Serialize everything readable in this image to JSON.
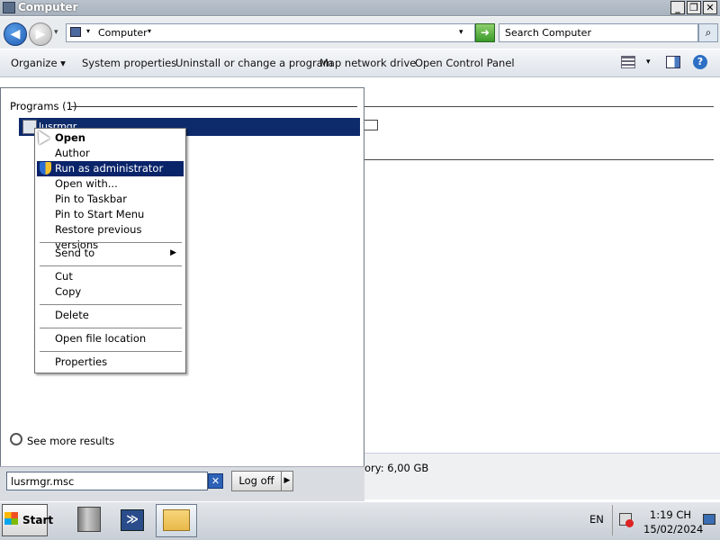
{
  "window": {
    "title": "Computer",
    "min": "_",
    "max": "❐",
    "close": "✕"
  },
  "nav": {
    "back": "◀",
    "forward": "▶",
    "history": "▾"
  },
  "address": {
    "sep": "▾",
    "label": "Computer",
    "sep2": "▾",
    "drop": "▾",
    "go": "➜"
  },
  "search": {
    "placeholder": "Search Computer",
    "icon": "⌕"
  },
  "toolbar": {
    "organize": "Organize ▾",
    "system_properties": "System properties",
    "uninstall": "Uninstall or change a program",
    "map_drive": "Map network drive",
    "control_panel": "Open Control Panel",
    "view_drop": "▾",
    "help": "?"
  },
  "background": {
    "memory": "ory: 6,00 GB"
  },
  "start_menu": {
    "programs_header": "Programs (1)",
    "result": "lusrmgr",
    "see_more": "See more results",
    "search_value": "lusrmgr.msc",
    "clear": "✕",
    "logoff": "Log off",
    "logoff_arrow": "▶"
  },
  "context_menu": {
    "items": [
      "Open",
      "Author",
      "Run as administrator",
      "Open with...",
      "Pin to Taskbar",
      "Pin to Start Menu",
      "Restore previous versions",
      "Send to",
      "Cut",
      "Copy",
      "Delete",
      "Open file location",
      "Properties"
    ],
    "submenu_arrow": "▶",
    "highlighted": "Run as administrator"
  },
  "taskbar": {
    "start": "Start",
    "powershell": "≫",
    "language": "EN",
    "time": "1:19 CH",
    "date": "15/02/2024"
  },
  "colors": {
    "highlight": "#0a246a",
    "selection": "#0d2a6b"
  }
}
